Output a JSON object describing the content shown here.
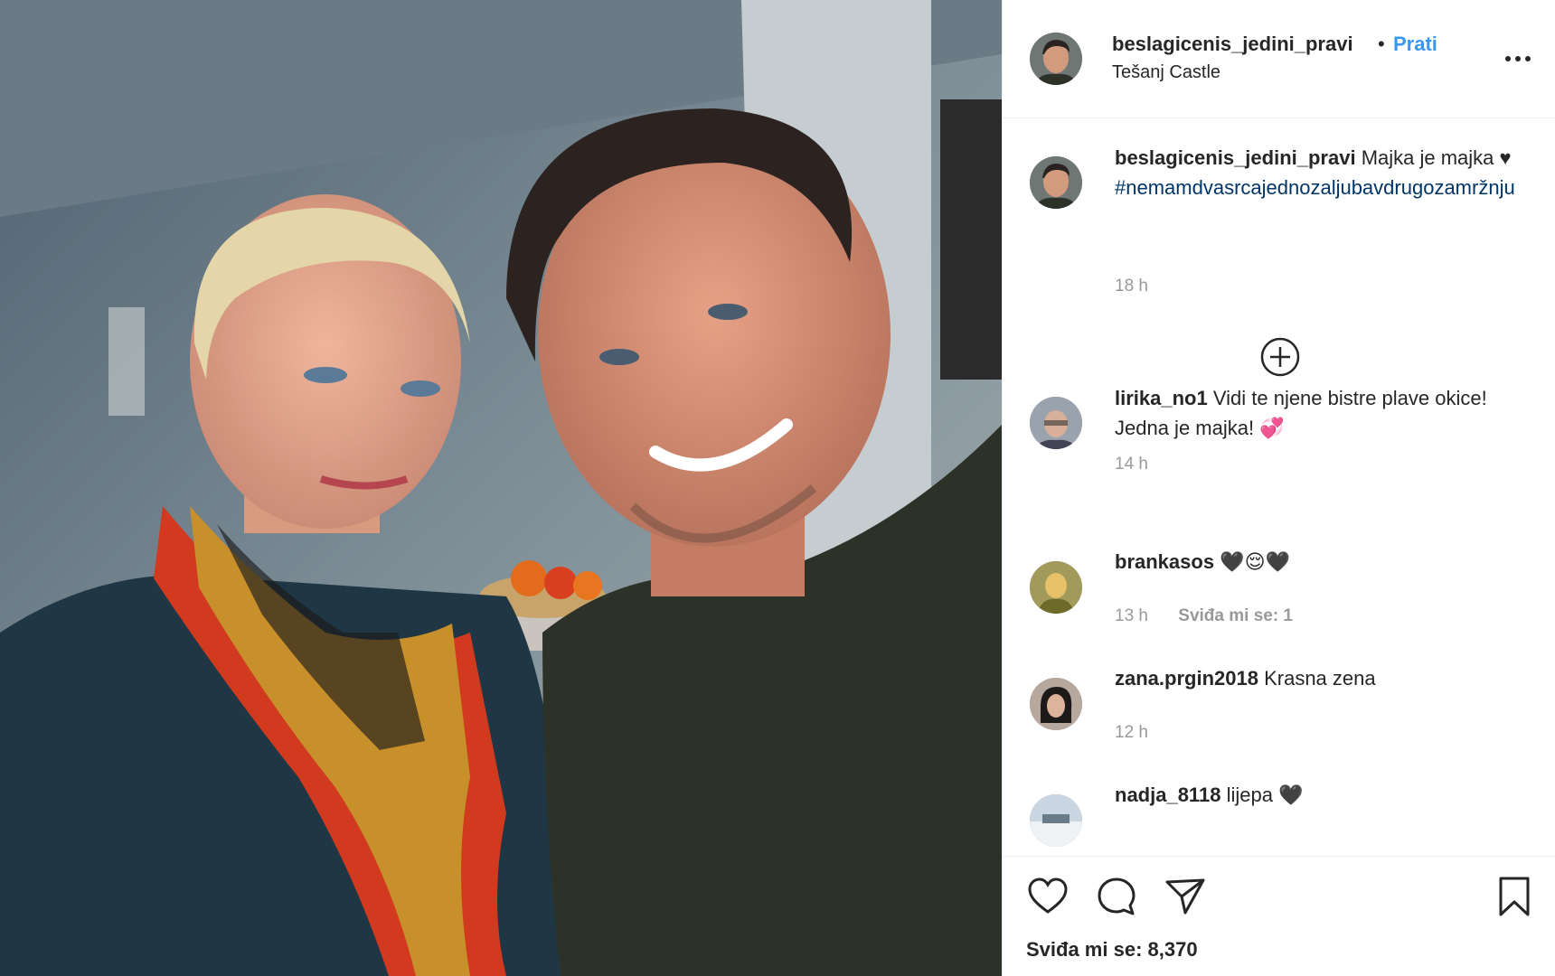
{
  "post": {
    "author": "beslagicenis_jedini_pravi",
    "separator": "•",
    "follow_label": "Prati",
    "location": "Tešanj Castle",
    "more_icon": "more-options-icon"
  },
  "caption": {
    "user": "beslagicenis_jedini_pravi",
    "text": "Majka je majka ♥",
    "hashtag": "#nemamdvasrcajednozaljubavdrugozamržnju",
    "time": "18 h"
  },
  "load_more_icon": "plus-circle-icon",
  "comments": [
    {
      "user": "lirika_no1",
      "text": "Vidi te njene bistre plave okice! Jedna je majka! 💞",
      "time": "14 h",
      "likes": ""
    },
    {
      "user": "brankasos",
      "text": "🖤😌🖤",
      "time": "13 h",
      "likes": "Sviđa mi se: 1"
    },
    {
      "user": "zana.prgin2018",
      "text": "Krasna zena",
      "time": "12 h",
      "likes": ""
    },
    {
      "user": "nadja_8118",
      "text": "lijepa 🖤",
      "time": "",
      "likes": ""
    }
  ],
  "actions": {
    "like_icon": "heart-icon",
    "comment_icon": "comment-bubble-icon",
    "share_icon": "paper-plane-icon",
    "save_icon": "bookmark-icon",
    "likes_text": "Sviđa mi se: 8,370"
  }
}
